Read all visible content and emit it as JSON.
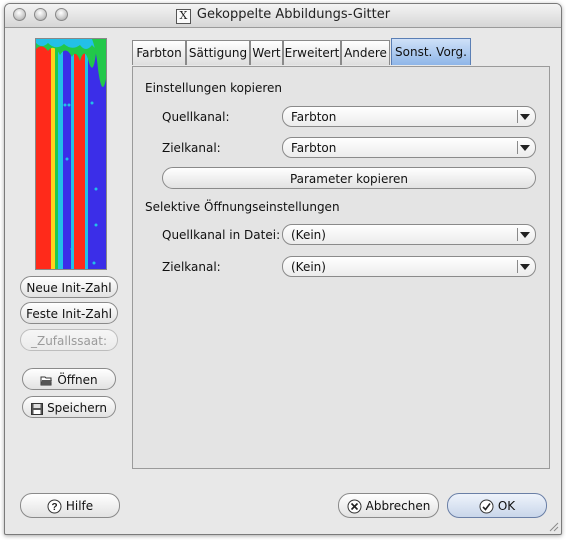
{
  "window": {
    "title": "Gekoppelte Abbildungs-Gitter"
  },
  "sidebar": {
    "buttons": {
      "new_seed": "Neue Init-Zahl",
      "fixed_seed": "Feste Init-Zahl",
      "random_seed": "_Zufallssaat:",
      "open": "Öffnen",
      "save": "Speichern"
    }
  },
  "tabs": [
    {
      "label": "Farbton"
    },
    {
      "label": "Sättigung"
    },
    {
      "label": "Wert"
    },
    {
      "label": "Erweitert"
    },
    {
      "label": "Andere"
    },
    {
      "label": "Sonst. Vorg."
    }
  ],
  "active_tab": "Sonst. Vorg.",
  "panel": {
    "copy_section": {
      "title": "Einstellungen kopieren",
      "source_label": "Quellkanal:",
      "source_value": "Farbton",
      "target_label": "Zielkanal:",
      "target_value": "Farbton",
      "copy_button": "Parameter kopieren"
    },
    "aperture_section": {
      "title": "Selektive Öffnungseinstellungen",
      "source_label": "Quellkanal in Datei:",
      "source_value": "(Kein)",
      "target_label": "Zielkanal:",
      "target_value": "(Kein)"
    }
  },
  "footer": {
    "help": "Hilfe",
    "cancel": "Abbrechen",
    "ok": "OK"
  },
  "colors": {
    "preview_red": "#ff2a1a",
    "preview_blue": "#3b2ee8",
    "preview_green": "#22c84a",
    "tab_active": "#8fb6e8"
  }
}
